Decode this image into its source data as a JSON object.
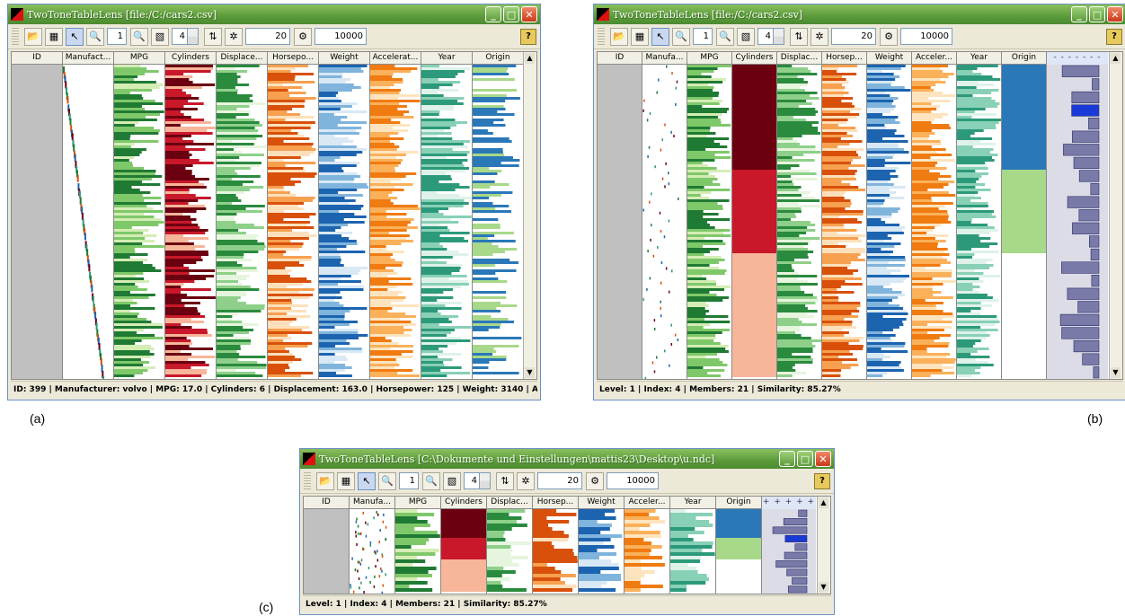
{
  "captions": {
    "a": "(a)",
    "b": "(b)",
    "c": "(c)"
  },
  "windows": [
    {
      "title": "TwoToneTableLens [file:/C:/cars2.csv]",
      "toolbar": {
        "zoom": "1",
        "level": "4",
        "count": "20",
        "max": "10000",
        "help": "?"
      },
      "columns": [
        "ID",
        "Manufact...",
        "MPG",
        "Cylinders",
        "Displace...",
        "Horsepo...",
        "Weight",
        "Accelerat...",
        "Year",
        "Origin"
      ],
      "status": "ID: 399 | Manufacturer: volvo | MPG: 17.0 | Cylinders: 6 | Displacement: 163.0 | Horsepower: 125 | Weight: 3140 | Acc..."
    },
    {
      "title": "TwoToneTableLens [file:/C:/cars2.csv]",
      "toolbar": {
        "zoom": "1",
        "level": "4",
        "count": "20",
        "max": "10000",
        "help": "?"
      },
      "columns": [
        "ID",
        "Manufa...",
        "MPG",
        "Cylinders",
        "Displac...",
        "Horsep...",
        "Weight",
        "Acceler...",
        "Year",
        "Origin"
      ],
      "histogram_header": "- - - - - - -",
      "status": "Level: 1 | Index: 4 | Members: 21 | Similarity: 85.27%"
    },
    {
      "title": "TwoToneTableLens [C:\\Dokumente und Einstellungen\\mattis23\\Desktop\\u.ndc]",
      "toolbar": {
        "zoom": "1",
        "level": "4",
        "count": "20",
        "max": "10000",
        "help": "?"
      },
      "columns": [
        "ID",
        "Manufa...",
        "MPG",
        "Cylinders",
        "Displac...",
        "Horsep...",
        "Weight",
        "Acceler...",
        "Year",
        "Origin"
      ],
      "histogram_header": "+ + + + + + +",
      "status": "Level: 1 | Index: 4 | Members: 21 | Similarity: 85.27%"
    }
  ],
  "colors": {
    "mpg": [
      "#1f7a33",
      "#7fc86a",
      "#d4edb5"
    ],
    "cylinders": [
      "#6b0010",
      "#c8182a",
      "#f7b59a"
    ],
    "displacement": [
      "#2a8a3e",
      "#8ed08a",
      "#e6f5dd"
    ],
    "horsepower": [
      "#d8500a",
      "#f7a050",
      "#fde0bb"
    ],
    "weight": [
      "#1c64b0",
      "#7fb4dc",
      "#d8e8f5"
    ],
    "acceleration": [
      "#f07b10",
      "#fbb05a",
      "#fee4be"
    ],
    "year": [
      "#2c9a7a",
      "#88d0b6",
      "#def2ea"
    ],
    "origin": [
      "#2a78b8",
      "#a8d88a",
      "#ffffff"
    ]
  }
}
